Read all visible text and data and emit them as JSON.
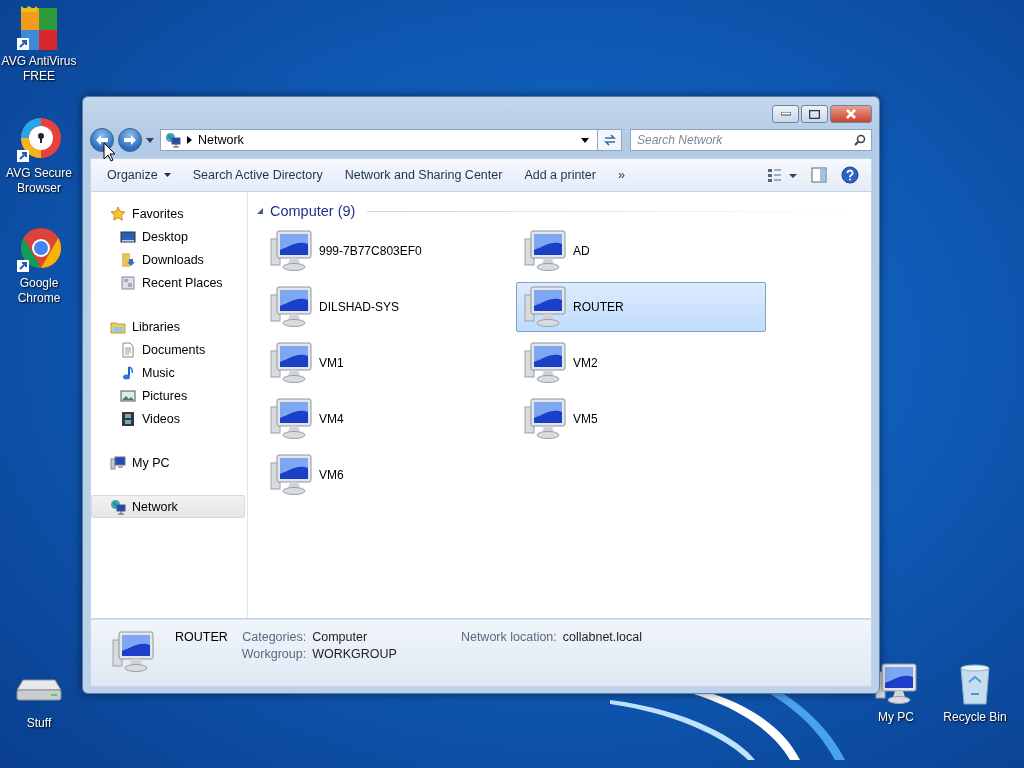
{
  "desktop_icons": [
    {
      "kind": "avg",
      "lines": [
        "AVG AntiVirus",
        "FREE"
      ],
      "shortcut": true
    },
    {
      "kind": "secure-browser",
      "lines": [
        "AVG Secure",
        "Browser"
      ],
      "shortcut": true
    },
    {
      "kind": "chrome",
      "lines": [
        "Google",
        "Chrome"
      ],
      "shortcut": true
    },
    {
      "kind": "drive",
      "lines": [
        "Stuff"
      ],
      "shortcut": false
    },
    {
      "kind": "pc",
      "lines": [
        "My PC"
      ],
      "shortcut": false
    },
    {
      "kind": "recycle",
      "lines": [
        "Recycle Bin"
      ],
      "shortcut": false
    }
  ],
  "window": {
    "address": {
      "crumb": "Network"
    },
    "search": {
      "placeholder": "Search Network"
    },
    "commands": [
      {
        "label": "Organize",
        "kind": "menu"
      },
      {
        "label": "Search Active Directory",
        "kind": "plain"
      },
      {
        "label": "Network and Sharing Center",
        "kind": "plain"
      },
      {
        "label": "Add a printer",
        "kind": "plain"
      },
      {
        "label": "»",
        "kind": "plain"
      }
    ],
    "sidebar": {
      "groups": [
        {
          "label": "Favorites",
          "kind": "star",
          "selected": false,
          "children": [
            {
              "label": "Desktop",
              "kind": "desktop",
              "selected": false
            },
            {
              "label": "Downloads",
              "kind": "downloads",
              "selected": false
            },
            {
              "label": "Recent Places",
              "kind": "recent",
              "selected": false
            }
          ]
        },
        {
          "label": "Libraries",
          "kind": "library",
          "selected": false,
          "children": [
            {
              "label": "Documents",
              "kind": "document",
              "selected": false
            },
            {
              "label": "Music",
              "kind": "music",
              "selected": false
            },
            {
              "label": "Pictures",
              "kind": "pictures",
              "selected": false
            },
            {
              "label": "Videos",
              "kind": "videos",
              "selected": false
            }
          ]
        },
        {
          "label": "My PC",
          "kind": "pc",
          "selected": false
        },
        {
          "label": "Network",
          "kind": "network",
          "selected": true
        }
      ]
    },
    "group": {
      "title": "Computer (9)",
      "expanded": true
    },
    "items": [
      {
        "label": "999-7B77C803EF0",
        "selected": false
      },
      {
        "label": "AD",
        "selected": false
      },
      {
        "label": "DILSHAD-SYS",
        "selected": false
      },
      {
        "label": "ROUTER",
        "selected": true
      },
      {
        "label": "VM1",
        "selected": false
      },
      {
        "label": "VM2",
        "selected": false
      },
      {
        "label": "VM4",
        "selected": false
      },
      {
        "label": "VM5",
        "selected": false
      },
      {
        "label": "VM6",
        "selected": false
      }
    ],
    "details": {
      "name": "ROUTER",
      "fields": [
        {
          "label": "Categories:",
          "value": "Computer"
        },
        {
          "label": "Workgroup:",
          "value": "WORKGROUP"
        }
      ],
      "location": {
        "label": "Network location:",
        "value": "collabnet.local"
      }
    }
  }
}
